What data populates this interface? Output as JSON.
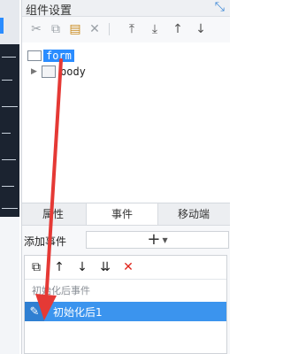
{
  "panel": {
    "title": "组件设置"
  },
  "toolbar": {
    "buttons": [
      {
        "name": "cut-icon",
        "glyph": "✂"
      },
      {
        "name": "copy-icon",
        "glyph": "⧉"
      },
      {
        "name": "paste-icon",
        "glyph": "📋"
      },
      {
        "name": "delete-icon",
        "glyph": "✕"
      },
      {
        "name": "move-top-icon",
        "glyph": "⤒"
      },
      {
        "name": "move-bottom-icon",
        "glyph": "⤓"
      },
      {
        "name": "move-up-icon",
        "glyph": "↑"
      },
      {
        "name": "move-down-icon",
        "glyph": "↓"
      }
    ]
  },
  "tree": {
    "root_label": "form",
    "child_label": "body"
  },
  "tabs": {
    "properties": "属性",
    "events": "事件",
    "mobile": "移动端"
  },
  "events": {
    "add_label": "添加事件",
    "group_label": "初始化后事件",
    "item_label": "初始化后1"
  },
  "colors": {
    "selection": "#2a8cff",
    "item_bg": "#3b94ee",
    "arrow": "#e53935"
  }
}
